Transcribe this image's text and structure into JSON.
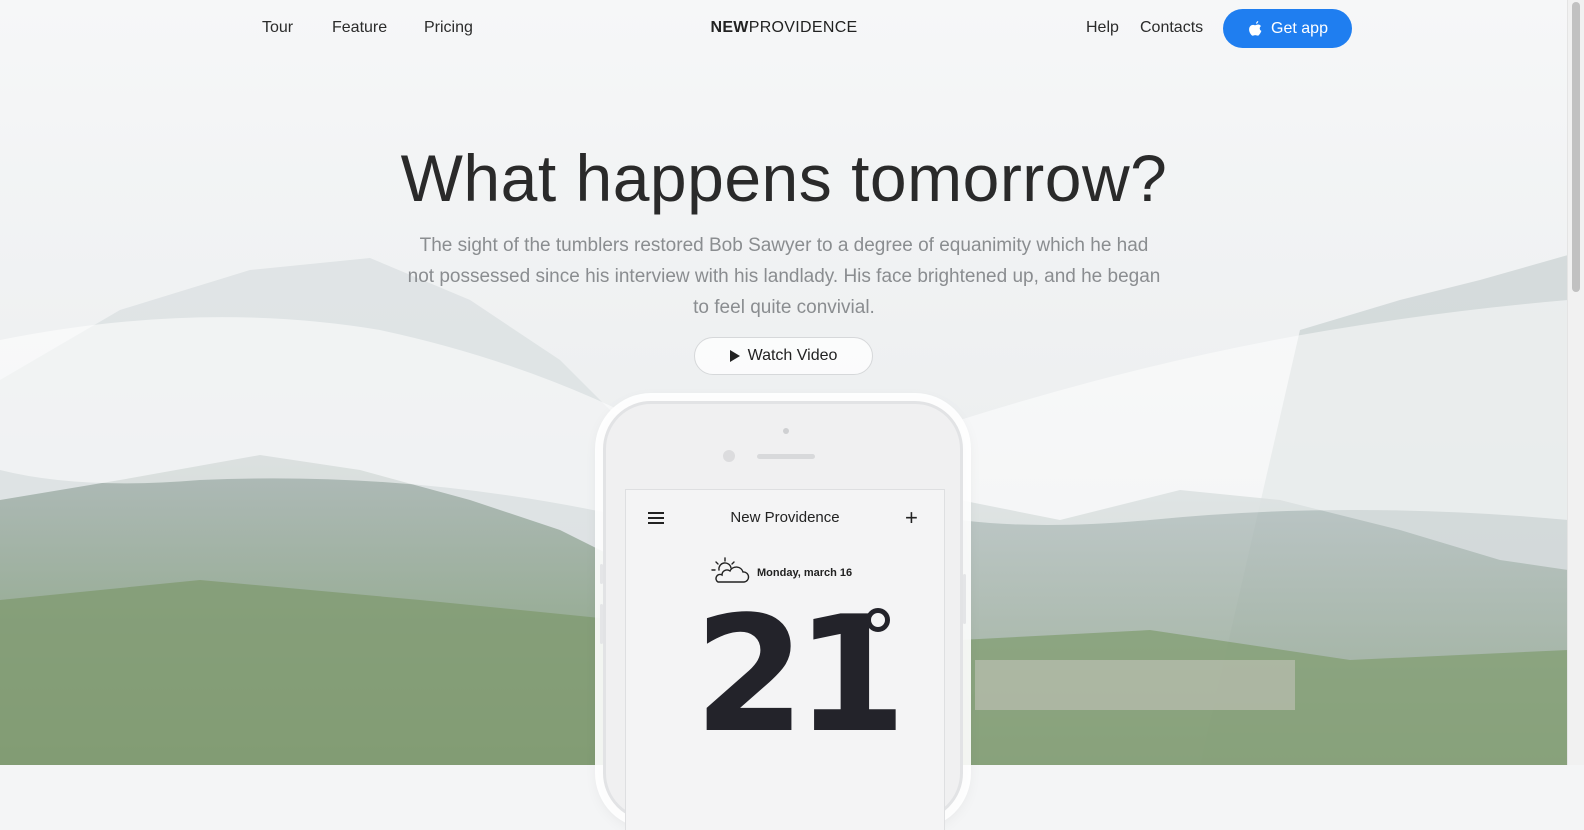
{
  "nav": {
    "links": [
      "Tour",
      "Feature",
      "Pricing"
    ],
    "brand_bold": "NEW",
    "brand_rest": "PROVIDENCE",
    "right_links": [
      "Help",
      "Contacts"
    ],
    "cta_label": "Get app",
    "cta_color": "#1f7ef0"
  },
  "hero": {
    "headline": "What happens tomorrow?",
    "subtext": "The sight of the tumblers restored Bob Sawyer to a degree of equanimity which he had not possessed since his interview with his landlady. His face brightened up, and he began to feel quite convivial.",
    "video_button": "Watch Video"
  },
  "phone_app": {
    "city": "New Providence",
    "date": "Monday, march 16",
    "temperature": "21",
    "icons": [
      "menu-icon",
      "plus-icon",
      "partly-cloudy-icon"
    ]
  }
}
